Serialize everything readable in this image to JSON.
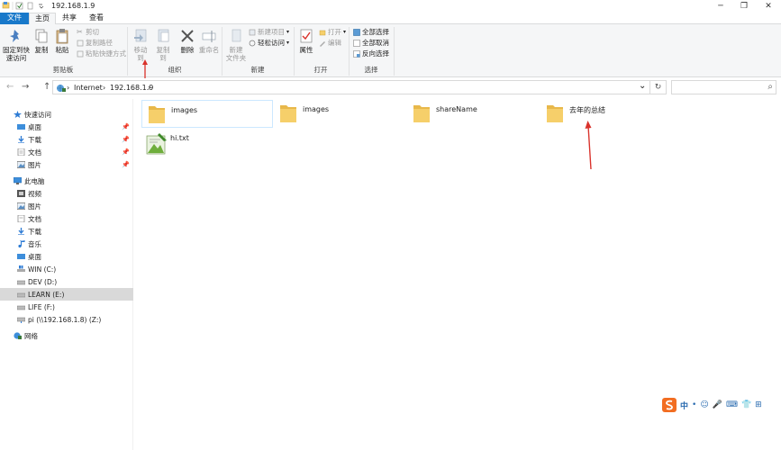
{
  "window": {
    "title": "192.168.1.9",
    "minimize_glyph": "─",
    "restore_glyph": "❐",
    "close_glyph": "✕"
  },
  "tabs": [
    {
      "label": "文件"
    },
    {
      "label": "主页"
    },
    {
      "label": "共享"
    },
    {
      "label": "查看"
    }
  ],
  "ribbon": {
    "clipboard": {
      "pin_label_1": "固定到快",
      "pin_label_2": "速访问",
      "copy": "复制",
      "paste": "粘贴",
      "cut": "剪切",
      "copy_path": "复制路径",
      "paste_shortcut": "粘贴快捷方式",
      "group": "剪贴板"
    },
    "organize": {
      "move_to": "移动到",
      "copy_to": "复制到",
      "delete": "删除",
      "rename": "重命名",
      "group": "组织"
    },
    "new": {
      "new_folder_1": "新建",
      "new_folder_2": "文件夹",
      "new_item": "新建项目",
      "easy_access": "轻松访问",
      "group": "新建"
    },
    "open": {
      "properties": "属性",
      "open": "打开",
      "edit": "编辑",
      "group": "打开"
    },
    "select": {
      "select_all": "全部选择",
      "select_none": "全部取消",
      "invert": "反向选择",
      "group": "选择"
    }
  },
  "address": {
    "back": "←",
    "forward": "→",
    "up": "↑",
    "crumbs": [
      "Internet",
      "192.168.1.9"
    ],
    "sep": "›",
    "dropdown": "⌄",
    "refresh": "↻",
    "search_glyph": "⌕"
  },
  "nav": {
    "quick_access": "快速访问",
    "quick_items": [
      "桌面",
      "下载",
      "文档",
      "图片"
    ],
    "pin": "📌",
    "this_pc": "此电脑",
    "pc_items": [
      "视频",
      "图片",
      "文档",
      "下载",
      "音乐",
      "桌面"
    ],
    "drives": [
      "WIN (C:)",
      "DEV (D:)",
      "LEARN (E:)",
      "LIFE (F:)",
      "pi (\\\\192.168.1.8) (Z:)"
    ],
    "network": "网络"
  },
  "content": {
    "items": [
      {
        "name": "images",
        "type": "folder"
      },
      {
        "name": "images",
        "type": "folder"
      },
      {
        "name": "shareName",
        "type": "folder"
      },
      {
        "name": "去年的总结",
        "type": "folder"
      },
      {
        "name": "hi.txt",
        "type": "file"
      }
    ]
  },
  "ime": {
    "items": [
      "中",
      "•",
      "☺",
      "🎤",
      "⌨",
      "👕",
      "⊞"
    ]
  },
  "colors": {
    "accent": "#1979ca",
    "folder": "#f6cf6a",
    "folder_dark": "#e8b84a",
    "arrow": "#d9322b",
    "selected_bg": "#d9d9d9"
  }
}
